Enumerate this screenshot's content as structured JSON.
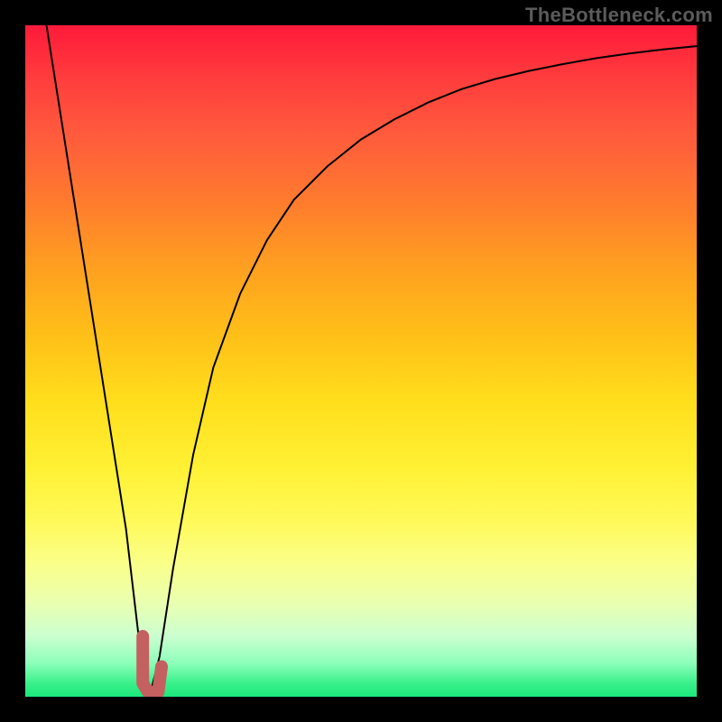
{
  "watermark": "TheBottleneck.com",
  "chart_data": {
    "type": "line",
    "title": "",
    "xlabel": "",
    "ylabel": "",
    "xlim": [
      0,
      100
    ],
    "ylim": [
      0,
      100
    ],
    "legend": false,
    "grid": false,
    "background_gradient": {
      "direction": "vertical",
      "top_color": "#ff1a3a",
      "bottom_color": "#1be87c"
    },
    "series": [
      {
        "name": "curve",
        "color": "#000000",
        "stroke_width": 2,
        "x": [
          3,
          6,
          9,
          12,
          15,
          17,
          18.5,
          20,
          22,
          25,
          28,
          32,
          36,
          40,
          45,
          50,
          55,
          60,
          65,
          70,
          75,
          80,
          85,
          90,
          95,
          100
        ],
        "values": [
          101,
          82,
          63,
          44,
          25,
          8,
          0,
          6,
          19,
          36,
          49,
          60,
          68,
          74,
          79,
          83,
          86,
          88.5,
          90.5,
          92,
          93.2,
          94.2,
          95.1,
          95.8,
          96.4,
          96.9
        ]
      },
      {
        "name": "marker",
        "color": "#c46060",
        "stroke_width": 14,
        "stroke_linecap": "round",
        "shape": "J",
        "x": [
          17.5,
          17.5,
          18.3,
          19.8,
          20.3
        ],
        "values": [
          9,
          2,
          0.7,
          0.7,
          4.5
        ]
      }
    ]
  }
}
